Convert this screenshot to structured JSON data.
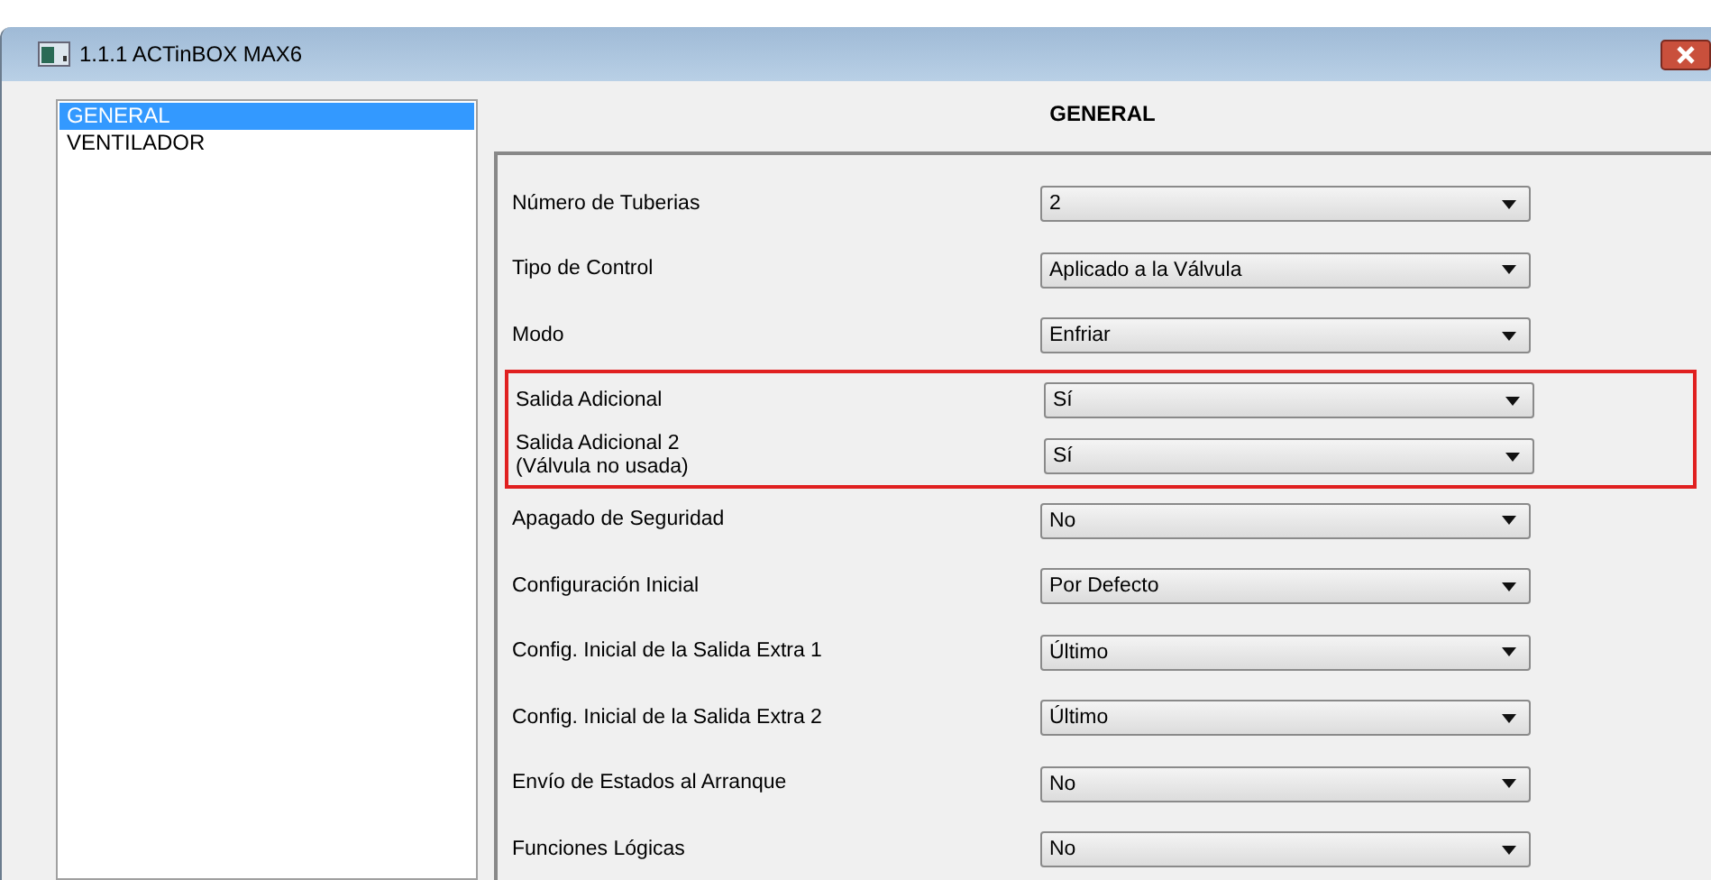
{
  "window": {
    "title": "1.1.1 ACTinBOX MAX6"
  },
  "sidebar": {
    "items": [
      {
        "label": "GENERAL",
        "selected": true
      },
      {
        "label": "VENTILADOR",
        "selected": false
      }
    ]
  },
  "panel": {
    "heading": "GENERAL",
    "rows": [
      {
        "label": "Número de Tuberias",
        "value": "2",
        "highlighted": false
      },
      {
        "label": "Tipo de Control",
        "value": "Aplicado a la Válvula",
        "highlighted": false
      },
      {
        "label": "Modo",
        "value": "Enfriar",
        "highlighted": false
      },
      {
        "label": "Salida Adicional",
        "value": "Sí",
        "highlighted": true
      },
      {
        "label": "Salida Adicional 2\n(Válvula no usada)",
        "value": "Sí",
        "highlighted": true
      },
      {
        "label": "Apagado de Seguridad",
        "value": "No",
        "highlighted": false
      },
      {
        "label": "Configuración Inicial",
        "value": "Por Defecto",
        "highlighted": false
      },
      {
        "label": "Config. Inicial de la Salida Extra 1",
        "value": "Último",
        "highlighted": false
      },
      {
        "label": "Config. Inicial de la Salida Extra 2",
        "value": "Último",
        "highlighted": false
      },
      {
        "label": "Envío de Estados al Arranque",
        "value": "No",
        "highlighted": false
      },
      {
        "label": "Funciones Lógicas",
        "value": "No",
        "highlighted": false
      }
    ]
  }
}
